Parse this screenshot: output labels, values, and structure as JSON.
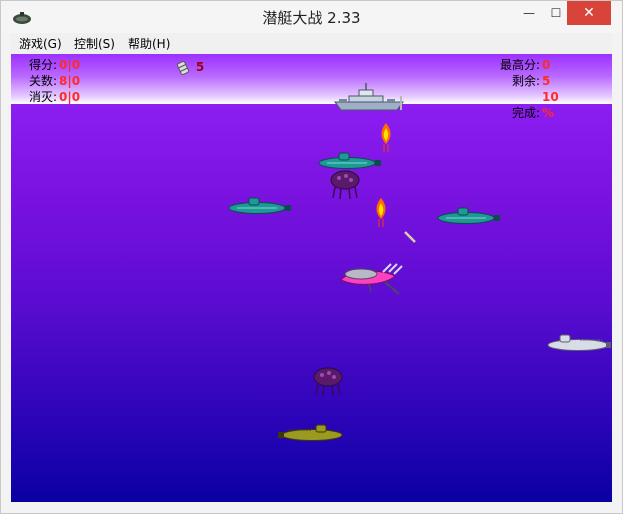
{
  "window": {
    "title": "潜艇大战 2.33",
    "minimize_label": "—",
    "maximize_label": "☐",
    "close_label": "✕"
  },
  "menu": {
    "items": [
      {
        "label": "游戏(G)"
      },
      {
        "label": "控制(S)"
      },
      {
        "label": "帮助(H)"
      }
    ]
  },
  "hud": {
    "score_label": "得分:",
    "score_value": "0|0",
    "level_label": "关数:",
    "level_value": "8|0",
    "destroyed_label": "消灭:",
    "destroyed_value": "0|0",
    "bomb_count": "5",
    "high_score_label": "最高分:",
    "high_score_value": "0",
    "remaining_label": "剩余:",
    "remaining_value": "5",
    "complete_label": "完成:",
    "complete_value": "10 %"
  },
  "colors": {
    "accent_red": "#ff2a2a",
    "water_top": "#9a2cff",
    "water_bottom": "#0a00a0"
  }
}
